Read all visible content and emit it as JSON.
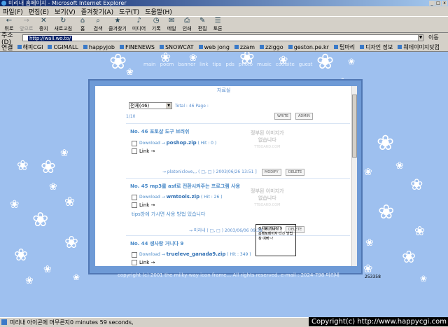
{
  "window": {
    "title": "미리내 홈페이지 - Microsoft Internet Explorer",
    "controls": [
      "_",
      "□",
      "x"
    ]
  },
  "menu": [
    "파일(F)",
    "편집(E)",
    "보기(V)",
    "즐겨찾기(A)",
    "도구(T)",
    "도움말(H)"
  ],
  "toolbar": {
    "buttons": [
      {
        "label": "뒤로",
        "icon": "←",
        "disabled": false
      },
      {
        "label": "앞으로",
        "icon": "→",
        "disabled": true
      },
      {
        "label": "중지",
        "icon": "✕",
        "disabled": false
      },
      {
        "label": "새로고침",
        "icon": "↻",
        "disabled": false
      },
      {
        "label": "홈",
        "icon": "⌂",
        "disabled": false
      },
      {
        "label": "검색",
        "icon": "⌕",
        "disabled": false
      },
      {
        "label": "즐겨찾기",
        "icon": "★",
        "disabled": false
      },
      {
        "label": "미디어",
        "icon": "♪",
        "disabled": false
      },
      {
        "label": "기록",
        "icon": "◷",
        "disabled": false
      },
      {
        "label": "메일",
        "icon": "✉",
        "disabled": false
      },
      {
        "label": "인쇄",
        "icon": "⎙",
        "disabled": false
      },
      {
        "label": "편집",
        "icon": "✎",
        "disabled": false
      },
      {
        "label": "토론",
        "icon": "☰",
        "disabled": false
      }
    ]
  },
  "address": {
    "label": "주소(D)",
    "url": "http://wall.wo.to/",
    "go_label": "이동"
  },
  "links": {
    "label": "연결",
    "items": [
      "해피CGI",
      "CGIMALL",
      "happyjob",
      "FINENEWS",
      "SNOWCAT",
      "web jong",
      "zzam",
      "zziggo",
      "geston.pe.kr",
      "팁마리",
      "디자인 정보",
      "웨데이미지닷컴"
    ]
  },
  "page": {
    "nav": [
      "main",
      "poem",
      "banner",
      "link",
      "tips",
      "pds",
      "photo",
      "music",
      "coolsite",
      "guest"
    ],
    "board": {
      "heading": "자료실",
      "select_value": "전체(46)",
      "total": "Total : 46 Page :",
      "page_indicator": "1/10",
      "write_label": "WRITE",
      "admin_label": "ADMIN",
      "modify_label": "MODIFY",
      "delete_label": "DELETE",
      "no_image_line1": "정부된 이미지가",
      "no_image_line2": "없습니다",
      "no_image_caption": "TTBOARD.COM",
      "posts": [
        {
          "number": "No. 46",
          "title": "포토샵 도구 브러쉬",
          "download": "Download → ",
          "file": "poshop.zip",
          "hits": "( Hit : 0 )",
          "link": "Link →",
          "poster": "→ platoniclove,,, ( □, □ ) 2003/06/26 13:51 ]"
        },
        {
          "number": "No. 45",
          "title": "mp3를 asf로 전환시켜주는 프로그램 사용",
          "download": "Download → ",
          "file": "wmtools.zip",
          "hits": "( Hit : 26 )",
          "link": "Link →",
          "desc": "tips방에 가시면 사용 방법 있습니다",
          "poster": "→ 미리내 ( □, □ ) 2003/06/06 09:38 ]"
        },
        {
          "number": "No. 44",
          "title": "생사랑 거니다 9",
          "download": "Download → ",
          "file": "trueleve_ganada9.zip",
          "hits": "( Hit : 349 )",
          "link": "Link →"
        }
      ],
      "thumb_lines": [
        "정사랑 거니다 9",
        "홈페토페이지 다진 방법",
        "참 예뻐~!"
      ]
    },
    "copyright": "copyright (c) 2001 the milky-way icon frame... All rights reserved. e-mail : 2024-798 미리내",
    "counter": "253358"
  },
  "status": {
    "text": "미리내 아이콘에 머무른지0 minutes 59 seconds,"
  },
  "watermark": "Copyright(c) http://www.happycgi.com"
}
